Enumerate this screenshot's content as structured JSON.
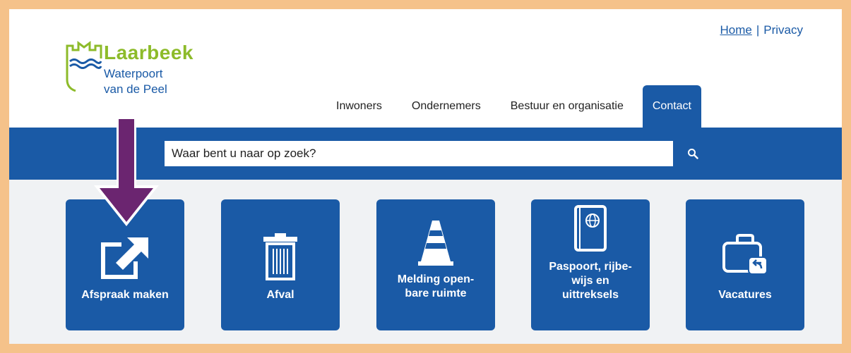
{
  "header": {
    "links": {
      "home": "Home",
      "separator": "|",
      "privacy": "Privacy"
    },
    "logo": {
      "name": "Laarbeek",
      "tagline_line1": "Waterpoort",
      "tagline_line2": "van de Peel"
    }
  },
  "nav": {
    "items": [
      {
        "label": "Inwoners"
      },
      {
        "label": "Ondernemers"
      },
      {
        "label": "Bestuur en organisatie"
      },
      {
        "label": "Contact"
      }
    ],
    "active": "Contact"
  },
  "search": {
    "placeholder": "Waar bent u naar op zoek?",
    "icon": "search-icon"
  },
  "tiles": [
    {
      "label": "Afspraak maken",
      "icon": "external-link-icon"
    },
    {
      "label": "Afval",
      "icon": "trash-can-icon"
    },
    {
      "label_line1": "Melding open-",
      "label_line2": "bare ruimte",
      "icon": "traffic-cone-icon"
    },
    {
      "label_line1": "Paspoort, rijbe-",
      "label_line2": "wijs en",
      "label_line3": "uittreksels",
      "icon": "passport-icon"
    },
    {
      "label": "Vacatures",
      "icon": "briefcase-icon"
    }
  ],
  "colors": {
    "brand_blue": "#1a5aa6",
    "brand_green": "#8dbb2a",
    "annotation_arrow": "#6b2570",
    "outer_border": "#f5c28a"
  }
}
